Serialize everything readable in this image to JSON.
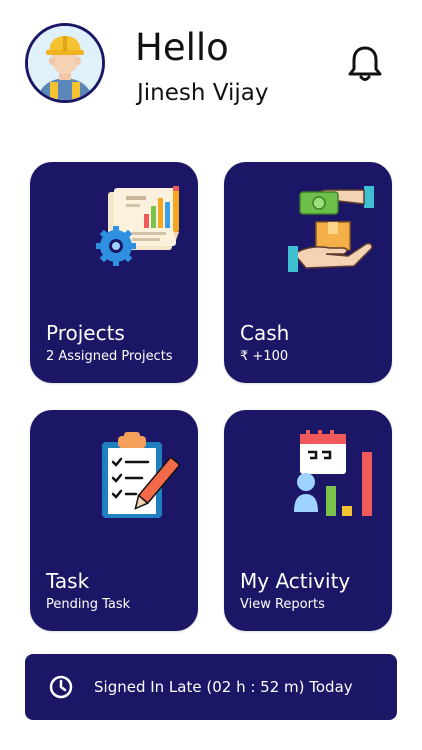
{
  "header": {
    "greeting": "Hello",
    "user_name": "Jinesh Vijay",
    "avatar_icon": "construction-worker-avatar",
    "notification_icon": "bell-icon"
  },
  "cards": [
    {
      "title": "Projects",
      "subtitle": "2 Assigned Projects",
      "icon": "projects-report-icon"
    },
    {
      "title": "Cash",
      "subtitle": "₹ +100",
      "icon": "cash-hand-icon"
    },
    {
      "title": "Task",
      "subtitle": "Pending Task",
      "icon": "clipboard-task-icon"
    },
    {
      "title": "My Activity",
      "subtitle": "View Reports",
      "icon": "activity-chart-icon"
    }
  ],
  "status_bar": {
    "text": "Signed In Late (02 h : 52 m) Today",
    "icon": "clock-icon"
  },
  "colors": {
    "card_background": "#1b1766",
    "page_background": "#ffffff",
    "text_primary": "#111111",
    "text_on_card": "#ffffff"
  }
}
